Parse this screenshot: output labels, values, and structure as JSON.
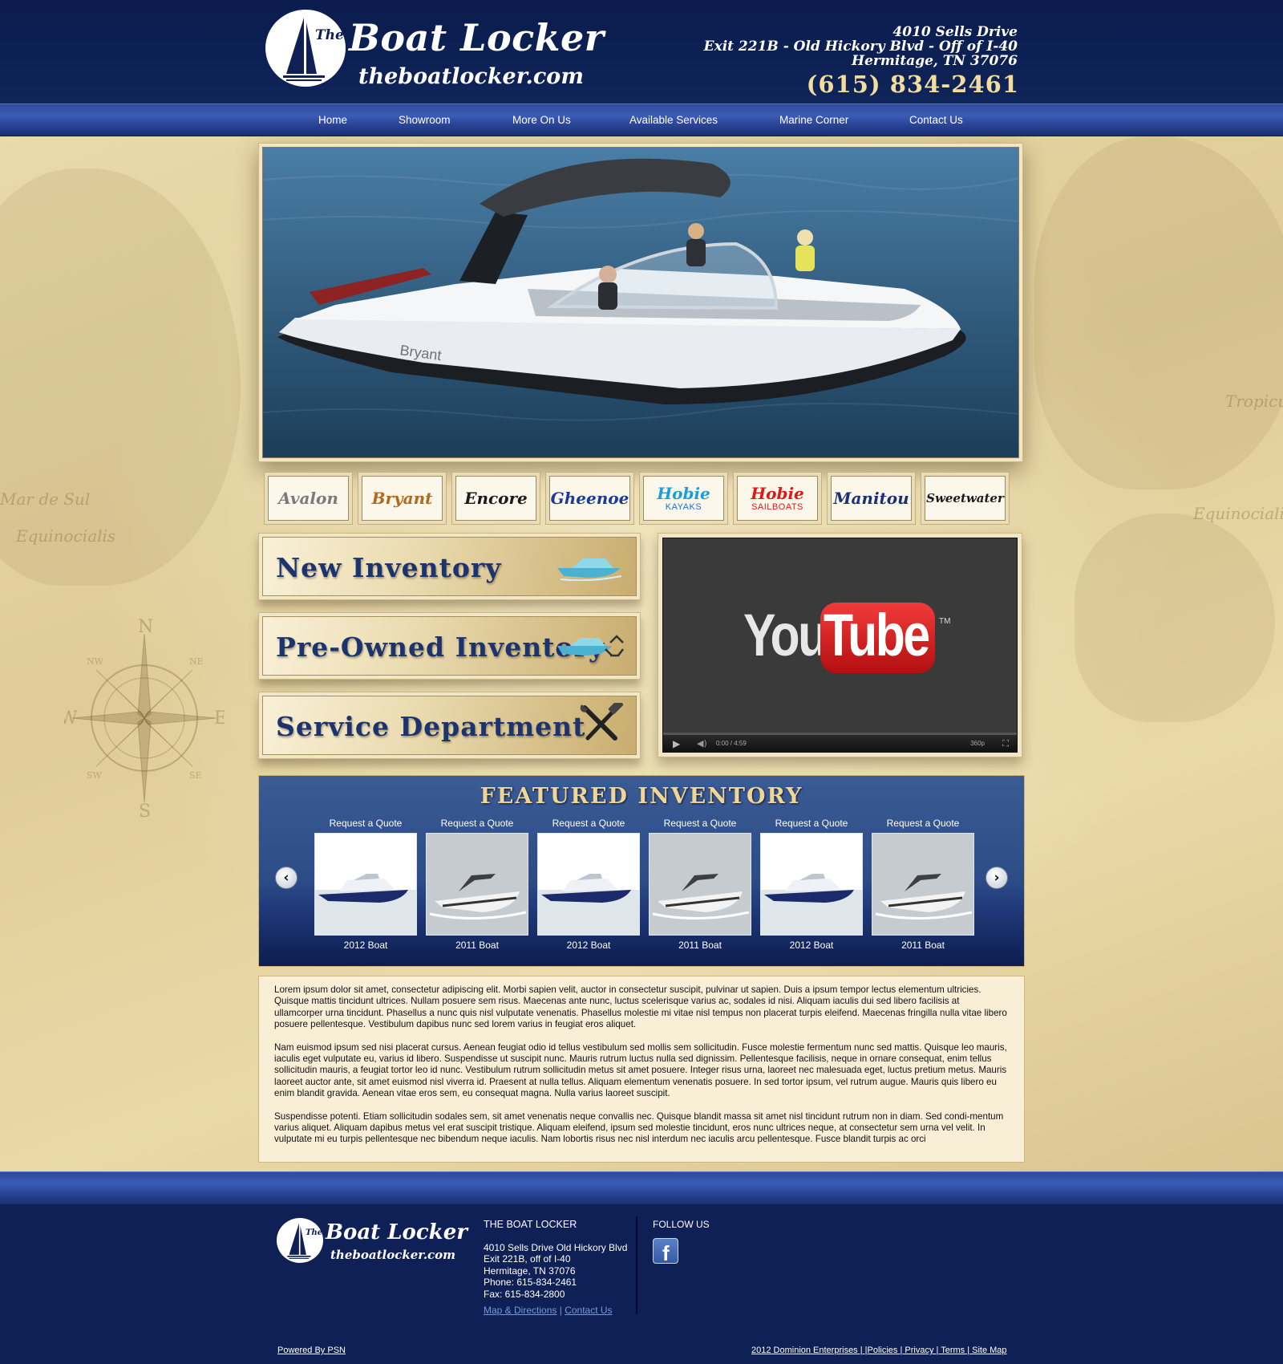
{
  "header": {
    "logo_the": "The",
    "logo_name": "Boat Locker",
    "logo_url": "theboatlocker.com",
    "address_line1": "4010 Sells Drive",
    "address_line2": "Exit 221B - Old Hickory Blvd - Off of I-40",
    "address_line3": "Hermitage, TN 37076",
    "phone": "(615) 834-2461"
  },
  "nav": {
    "items": [
      "Home",
      "Showroom",
      "More On Us",
      "Available Services",
      "Marine Corner",
      "Contact Us"
    ]
  },
  "map": {
    "words": [
      "Tropicus",
      "Equinocialis",
      "Mar de Sul",
      "Equinocialis"
    ],
    "compass": [
      "N",
      "E",
      "S",
      "W",
      "NE",
      "NW",
      "SE",
      "SW"
    ]
  },
  "hero": {
    "boat_hull_text": "Bryant"
  },
  "brands": [
    {
      "name": "Avalon",
      "sub": "",
      "color": "#7a7a7a"
    },
    {
      "name": "Bryant",
      "sub": "",
      "color": "#b06a1a"
    },
    {
      "name": "Encore",
      "sub": "",
      "color": "#1a1a1a"
    },
    {
      "name": "Gheenoe",
      "sub": "",
      "color": "#1a3aa0"
    },
    {
      "name": "Hobie",
      "sub": "KAYAKS",
      "color": "#1a9ed8"
    },
    {
      "name": "Hobie",
      "sub": "SAILBOATS",
      "color": "#d81a1a"
    },
    {
      "name": "Manitou",
      "sub": "",
      "color": "#17307a"
    },
    {
      "name": "Sweetwater",
      "sub": "",
      "color": "#1a1a1a"
    }
  ],
  "inventory_buttons": {
    "new": "New Inventory",
    "preowned": "Pre-Owned Inventory",
    "service": "Service Department"
  },
  "video": {
    "logo_you": "You",
    "logo_tube": "Tube",
    "logo_tm": "TM",
    "time": "0:00 / 4:59",
    "quality": "360p"
  },
  "featured": {
    "title": "FEATURED INVENTORY",
    "prev_icon": "chevron-left-icon",
    "next_icon": "chevron-right-icon",
    "items": [
      {
        "quote": "Request a Quote",
        "label": "2012 Boat",
        "kind": "cruiser"
      },
      {
        "quote": "Request a Quote",
        "label": "2011 Boat",
        "kind": "bowrider"
      },
      {
        "quote": "Request a Quote",
        "label": "2012 Boat",
        "kind": "cruiser"
      },
      {
        "quote": "Request a Quote",
        "label": "2011 Boat",
        "kind": "bowrider"
      },
      {
        "quote": "Request a Quote",
        "label": "2012 Boat",
        "kind": "cruiser"
      },
      {
        "quote": "Request a Quote",
        "label": "2011 Boat",
        "kind": "bowrider"
      }
    ]
  },
  "body_text": {
    "p1": "Lorem ipsum dolor sit amet, consectetur adipiscing elit. Morbi sapien velit, auctor in consectetur suscipit, pulvinar ut sapien. Duis a ipsum tempor lectus elementum ultricies. Quisque mattis tincidunt ultrices. Nullam posuere sem risus. Maecenas ante nunc, luctus scelerisque varius ac, sodales id nisi. Aliquam iaculis dui sed libero facilisis at ullamcorper urna tincidunt. Phasellus a nunc quis nisl vulputate venenatis. Phasellus molestie mi vitae nisl tempus non placerat turpis eleifend. Maecenas fringilla nulla vitae libero posuere pellentesque. Vestibulum dapibus nunc sed lorem varius in feugiat eros aliquet.",
    "p2": "Nam euismod ipsum sed nisi placerat cursus. Aenean feugiat odio id tellus vestibulum sed mollis sem sollicitudin. Fusce molestie fermentum nunc sed mattis. Quisque leo mauris, iaculis eget vulputate eu, varius id libero. Suspendisse ut suscipit nunc. Mauris rutrum luctus nulla sed dignissim. Pellentesque facilisis, neque in ornare consequat, enim tellus sollicitudin mauris, a feugiat tortor leo id nunc. Vestibulum rutrum sollicitudin metus sit amet posuere. Integer risus urna, laoreet nec malesuada eget, luctus pretium metus. Mauris laoreet auctor ante, sit amet euismod nisl viverra id. Praesent at nulla tellus. Aliquam elementum venenatis posuere. In sed tortor ipsum, vel rutrum augue. Mauris quis libero eu enim blandit gravida. Aenean vitae eros sem, eu consequat magna. Nulla varius laoreet suscipit.",
    "p3": "Suspendisse potenti. Etiam sollicitudin sodales sem, sit amet venenatis neque convallis nec. Quisque blandit massa sit amet nisl tincidunt rutrum non in diam. Sed condi-mentum varius aliquet. Aliquam dapibus metus vel erat suscipit tristique. Aliquam eleifend, ipsum sed molestie tincidunt, eros nunc ultrices neque, at consectetur sem urna vel velit. In vulputate mi eu turpis pellentesque nec bibendum neque iaculis. Nam lobortis risus nec nisl interdum nec iaculis arcu pellentesque. Fusce blandit turpis ac orci"
  },
  "footer": {
    "logo_the": "The",
    "logo_name": "Boat Locker",
    "logo_url": "theboatlocker.com",
    "company": "THE BOAT LOCKER",
    "addr1": "4010 Sells Drive Old Hickory Blvd",
    "addr2": "Exit 221B, off of I-40",
    "addr3": "Hermitage, TN 37076",
    "phone": "Phone: 615-834-2461",
    "fax": "Fax: 615-834-2800",
    "map_link": "Map & Directions",
    "sep": "|",
    "contact_link": "Contact Us",
    "follow": "FOLLOW US",
    "facebook_glyph": "f",
    "powered": "Powered By PSN",
    "legal": "2012 Dominion Enterprises | |Policies | Privacy | Terms | Site Map"
  }
}
